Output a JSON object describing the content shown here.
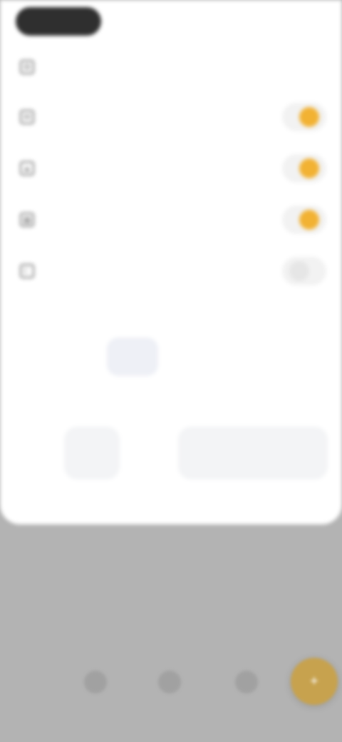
{
  "status": {
    "pill_text": "",
    "time": ""
  },
  "settings": {
    "items": [
      {
        "icon": "gear-icon",
        "label": "",
        "state": "none"
      },
      {
        "icon": "bell-icon",
        "label": "",
        "state": "on"
      },
      {
        "icon": "shield-icon",
        "label": "",
        "state": "on"
      },
      {
        "icon": "grid-icon",
        "label": "",
        "state": "on"
      },
      {
        "icon": "moon-icon",
        "label": "",
        "state": "off"
      }
    ],
    "section1_title": "",
    "segments": [
      {
        "label": "",
        "active": true
      },
      {
        "label": "",
        "active": false
      },
      {
        "label": "",
        "active": false
      }
    ],
    "section2_title": "",
    "buttons": {
      "left": "",
      "right": ""
    }
  },
  "bottom_nav": {
    "icons": [
      "home-icon",
      "search-icon",
      "chat-icon"
    ],
    "fab_icon": "plus-icon"
  },
  "colors": {
    "accent": "#f2b233",
    "scrim": "#b3b3b3",
    "sheet": "#ffffff"
  }
}
